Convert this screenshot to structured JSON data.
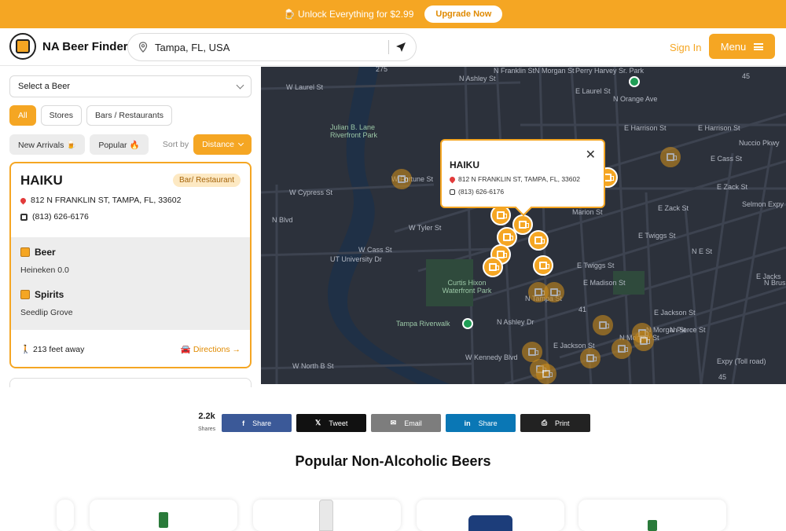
{
  "promo": {
    "text": "🍺 Unlock Everything for $2.99",
    "button": "Upgrade Now"
  },
  "header": {
    "brand": "NA Beer Finder",
    "location": "Tampa, FL, USA",
    "sign_in": "Sign In",
    "menu": "Menu"
  },
  "sidebar": {
    "select_beer": "Select a Beer",
    "filters": [
      "All",
      "Stores",
      "Bars / Restaurants"
    ],
    "new_arrivals": "New Arrivals 🍺",
    "popular": "Popular 🔥",
    "sort_by": "Sort by",
    "sort_value": "Distance"
  },
  "card": {
    "name": "HAIKU",
    "badge": "Bar/ Restaurant",
    "address": "812 N FRANKLIN ST, TAMPA, FL, 33602",
    "phone": "(813) 626-6176",
    "beer_label": "Beer",
    "beer_item": "Heineken 0.0",
    "spirits_label": "Spirits",
    "spirits_item": "Seedlip Grove",
    "distance": "🚶 213 feet away",
    "directions": "🚘 Directions →"
  },
  "popup": {
    "name": "HAIKU",
    "address": "812 N FRANKLIN ST, TAMPA, FL, 33602",
    "phone": "(813) 626-6176"
  },
  "map_labels": {
    "perry": "Perry Harvey Sr. Park",
    "laurel": "W Laurel St",
    "elaurel": "E Laurel St",
    "julian": "Julian B. Lane Riverfront Park",
    "eharrison": "E Harrison St",
    "eharrison2": "E Harrison St",
    "cass": "E Cass St",
    "zack": "E Zack St",
    "zack2": "E Zack St",
    "cypress": "W Cypress St",
    "fortune": "W Fortune St",
    "tyler": "W Tyler St",
    "wcass": "W Cass St",
    "twiggs": "E Twiggs St",
    "twiggs2": "E Twiggs St",
    "madison": "E Madison St",
    "curtis": "Curtis Hixon Waterfront Park",
    "riverwalk": "Tampa Riverwalk",
    "jackson": "E Jackson St",
    "jackson2": "E Jackson St",
    "kennedy": "W Kennedy Blvd",
    "northb": "W North B St",
    "blvd": "N Blvd",
    "ut": "UT University Dr",
    "ashley": "N Ashley St",
    "franklin": "N Franklin St",
    "morgan": "N Morgan St",
    "orange": "N Orange Ave",
    "marion": "Marion St",
    "nest": "N E St",
    "selmon": "Selmon Expy (Toll road)",
    "jacksonr": "E Jacks",
    "brush": "N Brush St",
    "pierce": "N Pierce St",
    "nuccio": "Nuccio Pkwy",
    "n45a": "45",
    "n45b": "45",
    "n275": "275",
    "n41": "41",
    "tampast": "N Tampa St",
    "ashleydr": "N Ashley Dr",
    "morgan2": "N Morgan St",
    "morgan3": "N Morgan St",
    "expy": "Expy (Toll road)"
  },
  "share": {
    "count": "2.2k",
    "count_label": "Shares",
    "buttons": [
      {
        "label": "Share",
        "icon": "f",
        "color": "#3b5998"
      },
      {
        "label": "Tweet",
        "icon": "𝕏",
        "color": "#111111"
      },
      {
        "label": "Email",
        "icon": "✉",
        "color": "#7d7d7d"
      },
      {
        "label": "Share",
        "icon": "in",
        "color": "#0a77b5"
      },
      {
        "label": "Print",
        "icon": "⎙",
        "color": "#222222"
      }
    ]
  },
  "section_title": "Popular Non-Alcoholic Beers",
  "colors": {
    "accent": "#f5a623",
    "map_bg": "#2c313b"
  }
}
